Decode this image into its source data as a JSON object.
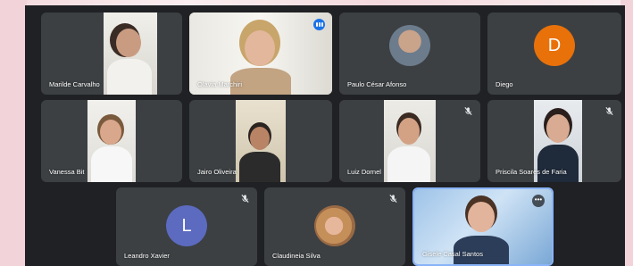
{
  "participants": [
    {
      "name": "Marilde Carvalho",
      "type": "video"
    },
    {
      "name": "Olavia Marchiri",
      "type": "video",
      "speaking": true
    },
    {
      "name": "Paulo César Afonso",
      "type": "photo"
    },
    {
      "name": "Diego",
      "type": "letter",
      "initial": "D",
      "color": "#e8710a"
    },
    {
      "name": "Vanessa Bit",
      "type": "video"
    },
    {
      "name": "Jairo Oliveira",
      "type": "video"
    },
    {
      "name": "Luiz Dornel",
      "type": "video",
      "muted": true
    },
    {
      "name": "Priscila Soares de Faria",
      "type": "video",
      "muted": true
    },
    {
      "name": "Leandro Xavier",
      "type": "letter",
      "initial": "L",
      "color": "#5c6bc0",
      "muted": true
    },
    {
      "name": "Claudineia Silva",
      "type": "photo",
      "muted": true
    },
    {
      "name": "Gisele Casal Santos",
      "type": "video",
      "pinned": true
    }
  ],
  "colors": {
    "background": "#202124",
    "tile": "#3c4043",
    "accent": "#1a73e8"
  }
}
